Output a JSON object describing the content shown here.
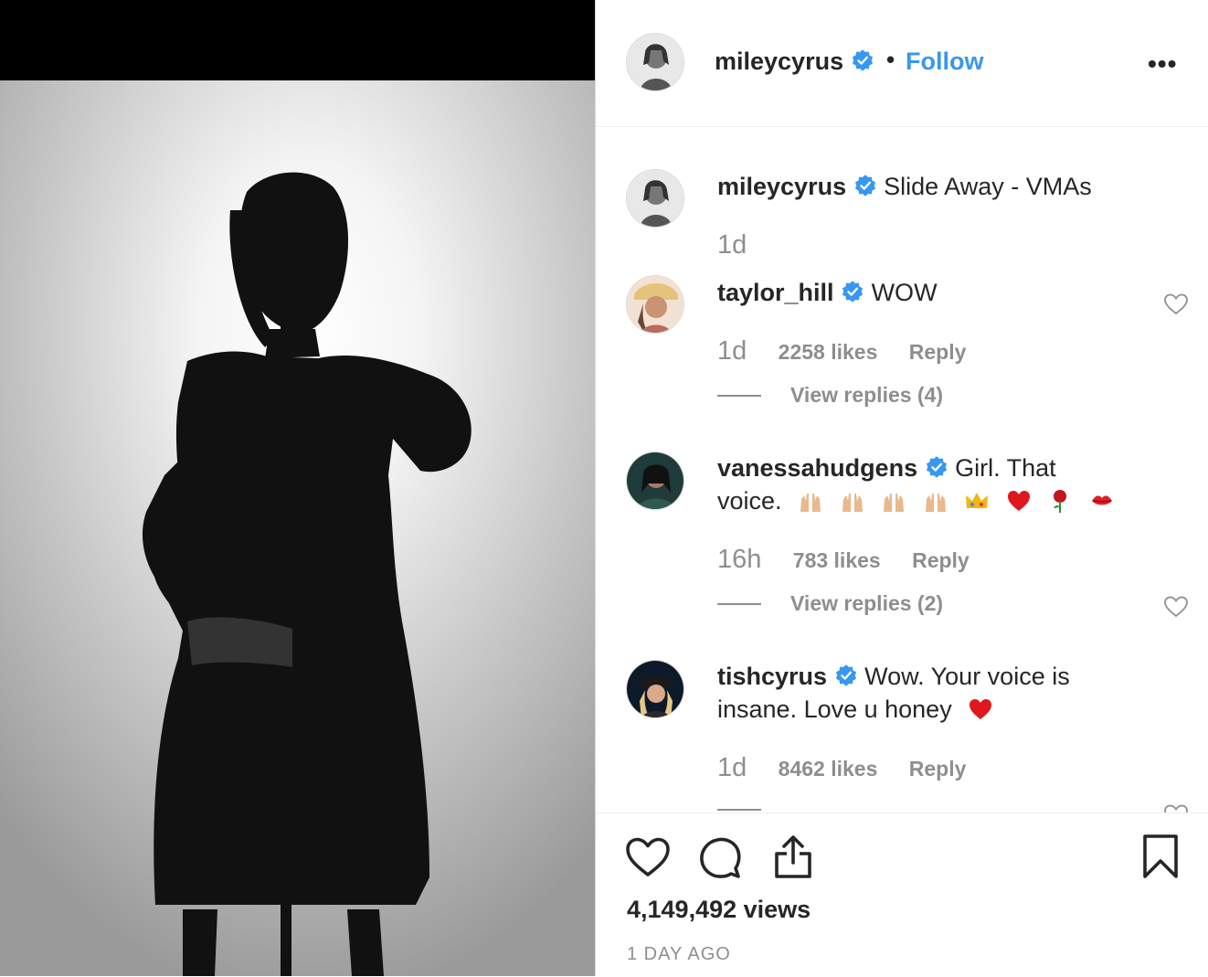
{
  "post": {
    "author": "mileycyrus",
    "follow_label": "Follow",
    "dot": "•",
    "more_label": "•••",
    "caption_user": "mileycyrus",
    "caption_text": "Slide Away - VMAs",
    "caption_time": "1d"
  },
  "comments": [
    {
      "user": "taylor_hill",
      "text": "WOW",
      "time": "1d",
      "likes": "2258 likes",
      "reply": "Reply",
      "view_replies": "View replies (4)"
    },
    {
      "user": "vanessahudgens",
      "text": "Girl. That voice.",
      "time": "16h",
      "likes": "783 likes",
      "reply": "Reply",
      "view_replies": "View replies (2)",
      "emojis": [
        "raising-hands",
        "raising-hands",
        "raising-hands",
        "raising-hands",
        "crown",
        "red-heart",
        "rose",
        "kiss-mark"
      ]
    },
    {
      "user": "tishcyrus",
      "text": "Wow. Your voice is insane. Love u honey",
      "time": "1d",
      "likes": "8462 likes",
      "reply": "Reply",
      "emojis": [
        "red-heart"
      ]
    }
  ],
  "footer": {
    "views": "4,149,492 views",
    "time_ago": "1 DAY AGO"
  },
  "icons": {
    "like": "heart-icon",
    "comment": "comment-bubble-icon",
    "share": "share-icon",
    "save": "bookmark-icon",
    "verified": "verified-badge-icon"
  },
  "colors": {
    "accent": "#3897f0",
    "muted": "#8e8e8e",
    "text": "#262626",
    "heart_red": "#e0171f"
  }
}
